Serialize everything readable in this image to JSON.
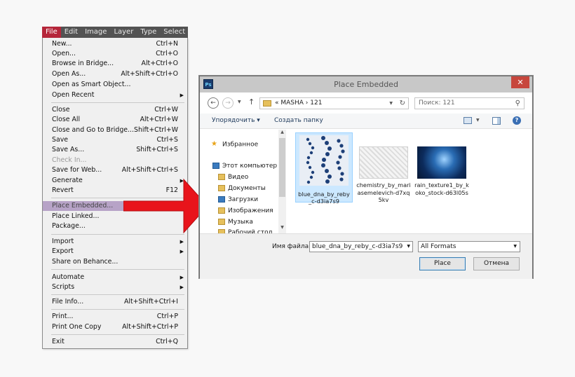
{
  "menubar": {
    "items": [
      {
        "label": "File",
        "active": true
      },
      {
        "label": "Edit"
      },
      {
        "label": "Image"
      },
      {
        "label": "Layer"
      },
      {
        "label": "Type"
      },
      {
        "label": "Select"
      }
    ]
  },
  "file_menu": {
    "items": [
      {
        "label": "New...",
        "shortcut": "Ctrl+N"
      },
      {
        "label": "Open...",
        "shortcut": "Ctrl+O"
      },
      {
        "label": "Browse in Bridge...",
        "shortcut": "Alt+Ctrl+O"
      },
      {
        "label": "Open As...",
        "shortcut": "Alt+Shift+Ctrl+O"
      },
      {
        "label": "Open as Smart Object...",
        "shortcut": ""
      },
      {
        "label": "Open Recent",
        "shortcut": "",
        "submenu": true
      },
      {
        "label": "Close",
        "shortcut": "Ctrl+W"
      },
      {
        "label": "Close All",
        "shortcut": "Alt+Ctrl+W"
      },
      {
        "label": "Close and Go to Bridge...",
        "shortcut": "Shift+Ctrl+W"
      },
      {
        "label": "Save",
        "shortcut": "Ctrl+S"
      },
      {
        "label": "Save As...",
        "shortcut": "Shift+Ctrl+S"
      },
      {
        "label": "Check In...",
        "shortcut": "",
        "disabled": true
      },
      {
        "label": "Save for Web...",
        "shortcut": "Alt+Shift+Ctrl+S"
      },
      {
        "label": "Generate",
        "shortcut": "",
        "submenu": true
      },
      {
        "label": "Revert",
        "shortcut": "F12"
      },
      {
        "label": "Place Embedded...",
        "shortcut": "",
        "highlighted": true
      },
      {
        "label": "Place Linked...",
        "shortcut": ""
      },
      {
        "label": "Package...",
        "shortcut": ""
      },
      {
        "label": "Import",
        "shortcut": "",
        "submenu": true
      },
      {
        "label": "Export",
        "shortcut": "",
        "submenu": true
      },
      {
        "label": "Share on Behance...",
        "shortcut": ""
      },
      {
        "label": "Automate",
        "shortcut": "",
        "submenu": true
      },
      {
        "label": "Scripts",
        "shortcut": "",
        "submenu": true
      },
      {
        "label": "File Info...",
        "shortcut": "Alt+Shift+Ctrl+I"
      },
      {
        "label": "Print...",
        "shortcut": "Ctrl+P"
      },
      {
        "label": "Print One Copy",
        "shortcut": "Alt+Shift+Ctrl+P"
      },
      {
        "label": "Exit",
        "shortcut": "Ctrl+Q"
      }
    ]
  },
  "dialog": {
    "app_icon": "Ps",
    "title": "Place Embedded",
    "close_label": "✕",
    "path": "«  MASHA  ›  121",
    "search_placeholder": "Поиск: 121",
    "organize_label": "Упорядочить ▾",
    "new_folder_label": "Создать папку",
    "help_label": "?",
    "nav": [
      {
        "label": "Избранное",
        "icon": "star-icon"
      },
      {
        "label": "Этот компьютер",
        "icon": "computer-icon"
      },
      {
        "label": "Видео",
        "icon": "folder-icon"
      },
      {
        "label": "Документы",
        "icon": "folder-icon"
      },
      {
        "label": "Загрузки",
        "icon": "download-icon"
      },
      {
        "label": "Изображения",
        "icon": "folder-icon"
      },
      {
        "label": "Музыка",
        "icon": "folder-icon"
      },
      {
        "label": "Рабочий стол",
        "icon": "folder-icon"
      }
    ],
    "files": [
      {
        "name": "blue_dna_by_reby_c-d3ia7s9",
        "selected": true
      },
      {
        "name": "chemistry_by_mariasemelevich-d7xq5kv"
      },
      {
        "name": "rain_texture1_by_koko_stock-d63l05s"
      }
    ],
    "filename_label": "Имя файла:",
    "filename_value": "blue_dna_by_reby_c-d3ia7s9",
    "filter_value": "All Formats",
    "place_label": "Place",
    "cancel_label": "Отмена"
  },
  "colors": {
    "menu_highlight": "#b7a3c7",
    "arrow": "#e8141b",
    "active_menu": "#b5263a",
    "selection": "#cce8ff"
  }
}
